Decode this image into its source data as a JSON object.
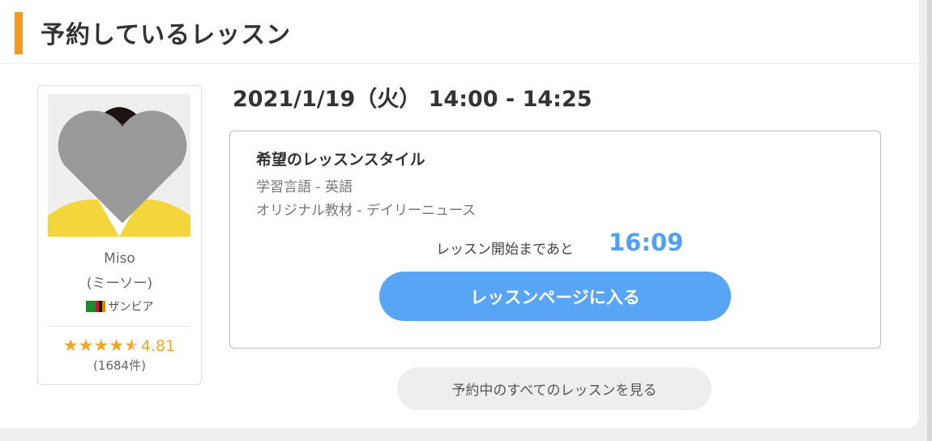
{
  "section": {
    "title": "予約しているレッスン"
  },
  "teacher": {
    "name": "Miso",
    "kana": "(ミーソー)",
    "country": "ザンビア",
    "rating": "4.81",
    "rating_value": 4.81,
    "review_count": "(1684件)",
    "icons": {
      "favorite": "heart-icon",
      "flag": "zambia-flag-icon",
      "star": "star-icon"
    }
  },
  "lesson": {
    "datetime": "2021/1/19（火） 14:00 - 14:25",
    "style_title": "希望のレッスンスタイル",
    "language_line": "学習言語 - 英語",
    "material_line": "オリジナル教材 - デイリーニュース",
    "countdown_label": "レッスン開始まであと",
    "countdown_value": "16:09",
    "enter_button": "レッスンページに入る"
  },
  "footer": {
    "all_lessons_button": "予約中のすべてのレッスンを見る"
  },
  "colors": {
    "accent": "#f39a26",
    "primary_button": "#59a5f5",
    "countdown": "#4ea1f3",
    "star": "#f5a623"
  }
}
